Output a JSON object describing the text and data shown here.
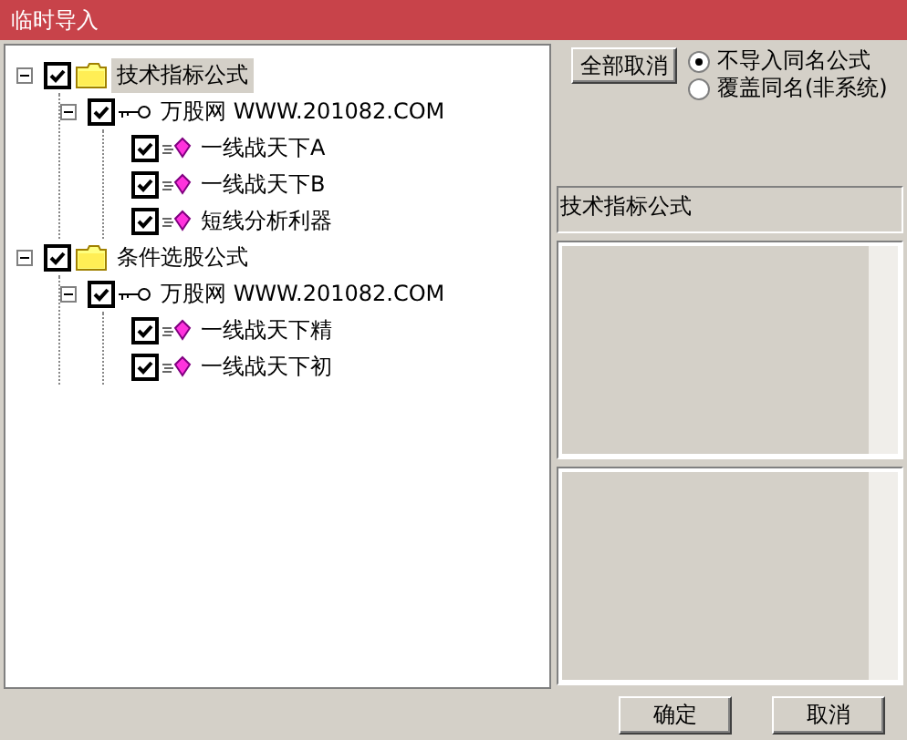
{
  "window": {
    "title": "临时导入"
  },
  "tree": [
    {
      "kind": "folder",
      "label": "技术指标公式",
      "checked": true,
      "expanded": true,
      "selected": true,
      "children": [
        {
          "kind": "group",
          "label": "万股网 WWW.201082.COM",
          "checked": true,
          "expanded": true,
          "selected": false,
          "children": [
            {
              "kind": "formula",
              "label": "一线战天下A",
              "checked": true,
              "selected": false
            },
            {
              "kind": "formula",
              "label": "一线战天下B",
              "checked": true,
              "selected": false
            },
            {
              "kind": "formula",
              "label": "短线分析利器",
              "checked": true,
              "selected": false
            }
          ]
        }
      ]
    },
    {
      "kind": "folder",
      "label": "条件选股公式",
      "checked": true,
      "expanded": true,
      "selected": false,
      "children": [
        {
          "kind": "group",
          "label": "万股网 WWW.201082.COM",
          "checked": true,
          "expanded": true,
          "selected": false,
          "children": [
            {
              "kind": "formula",
              "label": "一线战天下精",
              "checked": true,
              "selected": false
            },
            {
              "kind": "formula",
              "label": "一线战天下初",
              "checked": true,
              "selected": false
            }
          ]
        }
      ]
    }
  ],
  "toggle_button": "全部取消",
  "options": [
    {
      "label": "不导入同名公式",
      "selected": true
    },
    {
      "label": "覆盖同名(非系统)",
      "selected": false
    }
  ],
  "category_label": "技术指标公式",
  "buttons": [
    "确定",
    "取消"
  ]
}
